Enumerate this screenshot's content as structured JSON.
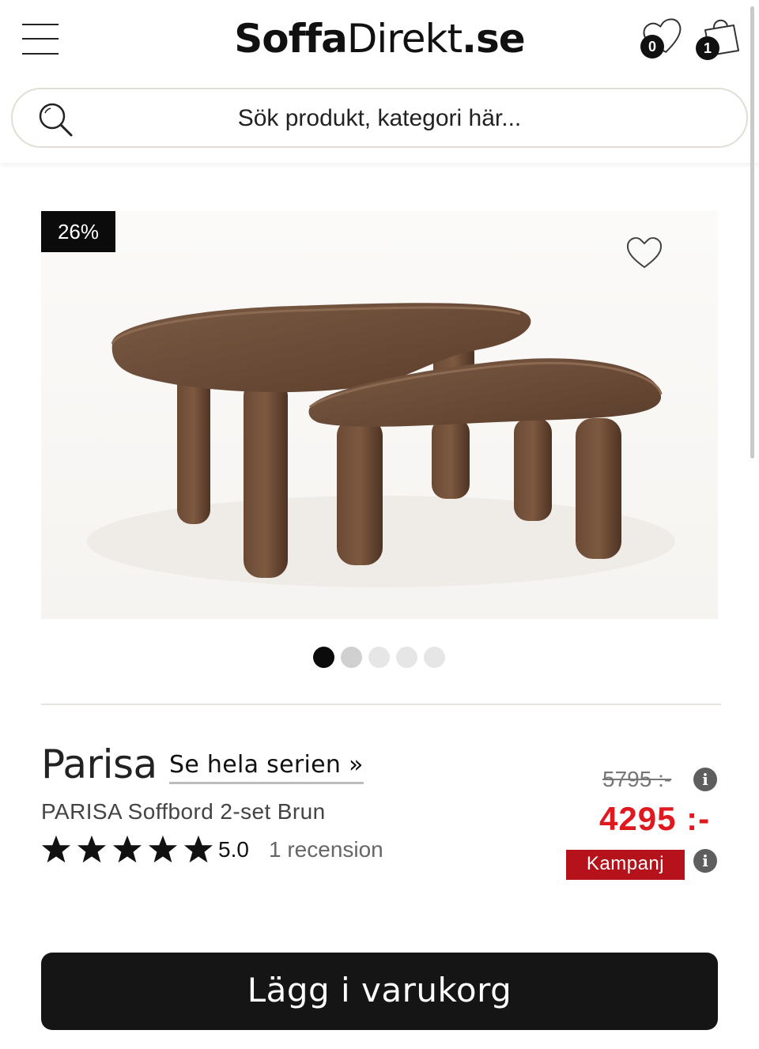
{
  "header": {
    "logo_bold": "Soffa",
    "logo_light": "Direkt",
    "logo_suffix": ".se",
    "wishlist_count": "0",
    "cart_count": "1",
    "menu_icon": "hamburger-menu-icon",
    "wishlist_icon": "heart-icon",
    "cart_icon": "shopping-bag-icon"
  },
  "search": {
    "placeholder": "Sök produkt, kategori här...",
    "icon": "search-icon"
  },
  "product": {
    "discount_badge": "26%",
    "favorite_icon": "heart-outline-icon",
    "image_description": "PARISA Soffbord 2-set Brun",
    "gallery": {
      "total": 5,
      "active_index": 0
    },
    "brand": "Parisa",
    "series_link": "Se hela serien »",
    "name": "PARISA Soffbord 2-set Brun",
    "rating": "5.0",
    "rating_value": 5,
    "rating_max": 5,
    "reviews": "1 recension",
    "old_price": "5795 :-",
    "price": "4295 :-",
    "campaign_label": "Kampanj",
    "add_to_cart": "Lägg i varukorg"
  },
  "colors": {
    "price_red": "#e0191f",
    "campaign_red": "#b5121b",
    "button_dark": "#151515"
  }
}
